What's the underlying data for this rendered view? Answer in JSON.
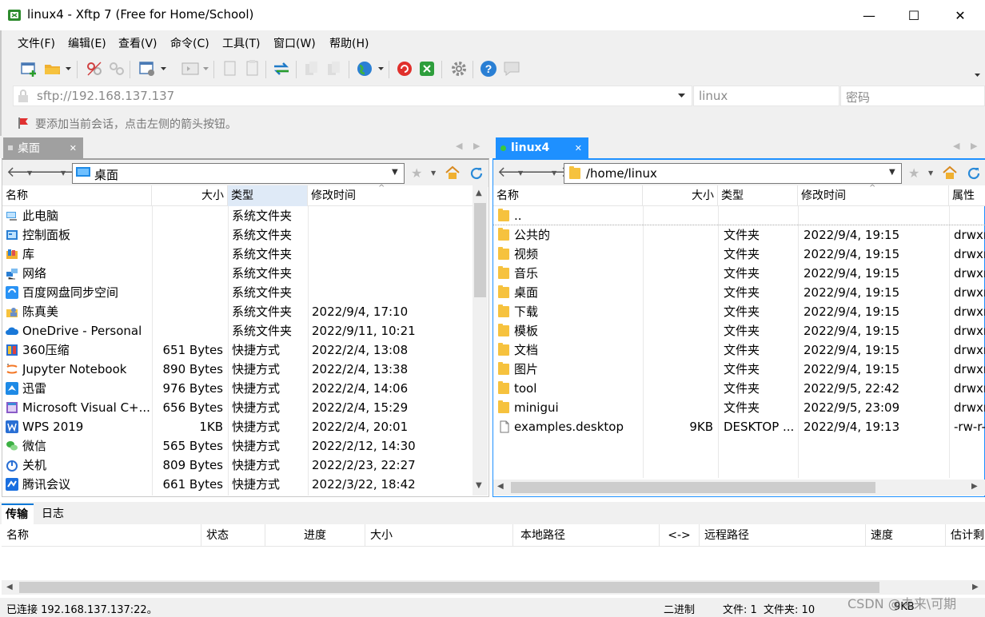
{
  "window": {
    "title": "linux4 - Xftp 7 (Free for Home/School)",
    "minimize_glyph": "—",
    "maximize_glyph": "☐",
    "close_glyph": "✕"
  },
  "menu": [
    "文件(F)",
    "编辑(E)",
    "查看(V)",
    "命令(C)",
    "工具(T)",
    "窗口(W)",
    "帮助(H)"
  ],
  "address": {
    "url": "sftp://192.168.137.137",
    "user_placeholder": "linux",
    "password_placeholder": "密码"
  },
  "hint": "要添加当前会话，点击左侧的箭头按钮。",
  "local": {
    "tab_label": "桌面",
    "path": "桌面",
    "columns": [
      "名称",
      "大小",
      "类型",
      "修改时间"
    ],
    "rows": [
      {
        "name": "此电脑",
        "size": "",
        "type": "系统文件夹",
        "mtime": "",
        "icon": "computer-icon"
      },
      {
        "name": "控制面板",
        "size": "",
        "type": "系统文件夹",
        "mtime": "",
        "icon": "control-panel-icon"
      },
      {
        "name": "库",
        "size": "",
        "type": "系统文件夹",
        "mtime": "",
        "icon": "library-icon"
      },
      {
        "name": "网络",
        "size": "",
        "type": "系统文件夹",
        "mtime": "",
        "icon": "network-icon"
      },
      {
        "name": "百度网盘同步空间",
        "size": "",
        "type": "系统文件夹",
        "mtime": "",
        "icon": "baidu-netdisk-icon"
      },
      {
        "name": "陈真美",
        "size": "",
        "type": "系统文件夹",
        "mtime": "2022/9/4, 17:10",
        "icon": "user-folder-icon"
      },
      {
        "name": "OneDrive - Personal",
        "size": "",
        "type": "系统文件夹",
        "mtime": "2022/9/11, 10:21",
        "icon": "onedrive-icon"
      },
      {
        "name": "360压缩",
        "size": "651 Bytes",
        "type": "快捷方式",
        "mtime": "2022/2/4, 13:08",
        "icon": "360zip-icon"
      },
      {
        "name": "Jupyter Notebook",
        "size": "890 Bytes",
        "type": "快捷方式",
        "mtime": "2022/2/4, 13:38",
        "icon": "jupyter-icon"
      },
      {
        "name": "迅雷",
        "size": "976 Bytes",
        "type": "快捷方式",
        "mtime": "2022/2/4, 14:06",
        "icon": "thunder-icon"
      },
      {
        "name": "Microsoft Visual C+...",
        "size": "656 Bytes",
        "type": "快捷方式",
        "mtime": "2022/2/4, 15:29",
        "icon": "visual-cpp-icon"
      },
      {
        "name": "WPS 2019",
        "size": "1KB",
        "type": "快捷方式",
        "mtime": "2022/2/4, 20:01",
        "icon": "wps-icon"
      },
      {
        "name": "微信",
        "size": "565 Bytes",
        "type": "快捷方式",
        "mtime": "2022/2/12, 14:30",
        "icon": "wechat-icon"
      },
      {
        "name": "关机",
        "size": "809 Bytes",
        "type": "快捷方式",
        "mtime": "2022/2/23, 22:27",
        "icon": "shutdown-icon"
      },
      {
        "name": "腾讯会议",
        "size": "661 Bytes",
        "type": "快捷方式",
        "mtime": "2022/3/22, 18:42",
        "icon": "tencent-meeting-icon"
      }
    ]
  },
  "remote": {
    "tab_label": "linux4",
    "path": "/home/linux",
    "columns": [
      "名称",
      "大小",
      "类型",
      "修改时间",
      "属性"
    ],
    "rows": [
      {
        "name": "..",
        "size": "",
        "type": "",
        "mtime": "",
        "attr": "",
        "icon": "folder-icon"
      },
      {
        "name": "公共的",
        "size": "",
        "type": "文件夹",
        "mtime": "2022/9/4, 19:15",
        "attr": "drwxr",
        "icon": "folder-icon"
      },
      {
        "name": "视频",
        "size": "",
        "type": "文件夹",
        "mtime": "2022/9/4, 19:15",
        "attr": "drwxr",
        "icon": "folder-icon"
      },
      {
        "name": "音乐",
        "size": "",
        "type": "文件夹",
        "mtime": "2022/9/4, 19:15",
        "attr": "drwxr",
        "icon": "folder-icon"
      },
      {
        "name": "桌面",
        "size": "",
        "type": "文件夹",
        "mtime": "2022/9/4, 19:15",
        "attr": "drwxr",
        "icon": "folder-icon"
      },
      {
        "name": "下载",
        "size": "",
        "type": "文件夹",
        "mtime": "2022/9/4, 19:15",
        "attr": "drwxr",
        "icon": "folder-icon"
      },
      {
        "name": "模板",
        "size": "",
        "type": "文件夹",
        "mtime": "2022/9/4, 19:15",
        "attr": "drwxr",
        "icon": "folder-icon"
      },
      {
        "name": "文档",
        "size": "",
        "type": "文件夹",
        "mtime": "2022/9/4, 19:15",
        "attr": "drwxr",
        "icon": "folder-icon"
      },
      {
        "name": "图片",
        "size": "",
        "type": "文件夹",
        "mtime": "2022/9/4, 19:15",
        "attr": "drwxr",
        "icon": "folder-icon"
      },
      {
        "name": "tool",
        "size": "",
        "type": "文件夹",
        "mtime": "2022/9/5, 22:42",
        "attr": "drwxr",
        "icon": "folder-icon"
      },
      {
        "name": "minigui",
        "size": "",
        "type": "文件夹",
        "mtime": "2022/9/5, 23:09",
        "attr": "drwxr",
        "icon": "folder-icon"
      },
      {
        "name": "examples.desktop",
        "size": "9KB",
        "type": "DESKTOP ...",
        "mtime": "2022/9/4, 19:13",
        "attr": "-rw-r-",
        "icon": "file-icon"
      }
    ]
  },
  "transfer": {
    "tabs": [
      "传输",
      "日志"
    ],
    "columns": [
      "名称",
      "状态",
      "进度",
      "大小",
      "本地路径",
      "<->",
      "远程路径",
      "速度",
      "估计剩"
    ]
  },
  "status": {
    "connected": "已连接 192.168.137.137:22。",
    "mode": "二进制",
    "files": "文件: 1  文件夹: 10",
    "size": "9KB",
    "watermark": "CSDN @未来\\可期"
  },
  "colors": {
    "accent": "#0078d7",
    "remote_tab": "#1e90ff",
    "connected_dot": "#3cc83c",
    "sort_header": "#dfeaf7"
  }
}
